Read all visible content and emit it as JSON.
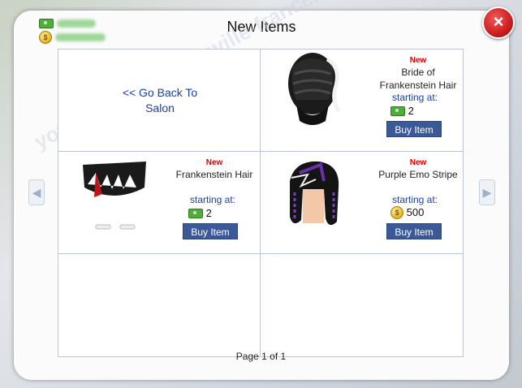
{
  "dialog": {
    "title": "New Items",
    "close_label": "×"
  },
  "currency": {
    "cash_icon": "cash-bill-icon",
    "coins_icon": "coin-icon",
    "coin_symbol": "$"
  },
  "back_link": {
    "label": "<< Go Back To Salon"
  },
  "items": [
    {
      "badge": "New",
      "name": "Bride of Frankenstein Hair",
      "starting_label": "starting at:",
      "currency_icon": "cash-bill-icon",
      "price": "2",
      "buy_label": "Buy Item"
    },
    {
      "badge": "New",
      "name": "Frankenstein Hair",
      "starting_label": "starting at:",
      "currency_icon": "cash-bill-icon",
      "price": "2",
      "buy_label": "Buy Item"
    },
    {
      "badge": "New",
      "name": "Purple Emo Stripe",
      "starting_label": "starting at:",
      "currency_icon": "coin-icon",
      "price": "500",
      "buy_label": "Buy Item"
    }
  ],
  "pagination": {
    "label": "Page 1 of 1",
    "prev_icon": "arrow-left-icon",
    "next_icon": "arrow-right-icon"
  },
  "colors": {
    "new_badge": "#d40000",
    "link": "#1a3fa8",
    "buy_button": "#3b5998",
    "close_button": "#c41414"
  }
}
